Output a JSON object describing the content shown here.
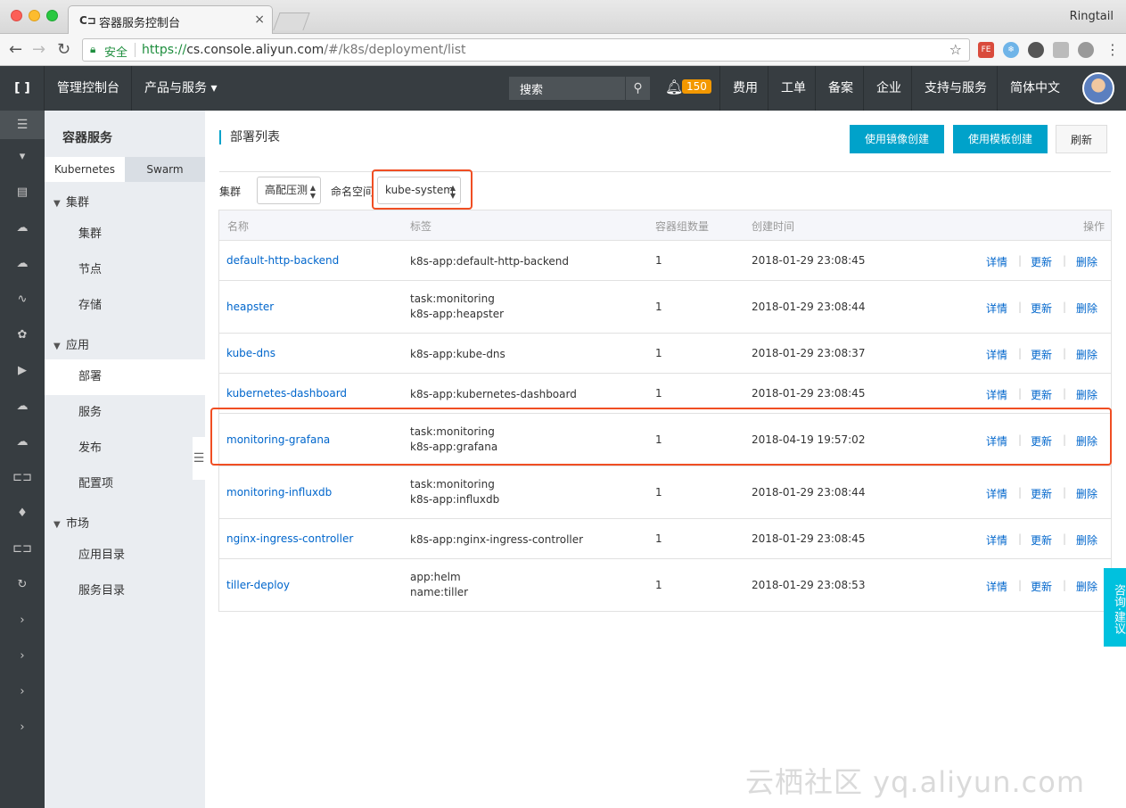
{
  "browser": {
    "tab_title": "容器服务控制台",
    "tab_icon": "C⊐",
    "profile_name": "Ringtail",
    "secure_label": "安全",
    "url_scheme": "https://",
    "url_host": "cs.console.aliyun.com",
    "url_path": "/#/k8s/deployment/list",
    "back_icon": "←",
    "forward_icon": "→",
    "reload_icon": "↻",
    "star_icon": "☆",
    "menu_icon": "⋮",
    "ext_fe": "FE"
  },
  "topnav": {
    "logo": "[ ]",
    "console_label": "管理控制台",
    "products_label": "产品与服务 ▾",
    "search_placeholder": "搜索",
    "notification_count": "150",
    "items": [
      "费用",
      "工单",
      "备案",
      "企业",
      "支持与服务",
      "简体中文"
    ]
  },
  "sidebar": {
    "title": "容器服务",
    "tabs": [
      "Kubernetes",
      "Swarm"
    ],
    "groups": [
      {
        "label": "集群",
        "items": [
          "集群",
          "节点",
          "存储"
        ]
      },
      {
        "label": "应用",
        "items": [
          "部署",
          "服务",
          "发布",
          "配置项"
        ]
      },
      {
        "label": "市场",
        "items": [
          "应用目录",
          "服务目录"
        ]
      }
    ],
    "active_item": "部署"
  },
  "main": {
    "title": "部署列表",
    "buttons": {
      "create_image": "使用镜像创建",
      "create_template": "使用模板创建",
      "refresh": "刷新"
    },
    "filters": {
      "cluster_label": "集群",
      "cluster_value": "高配压测",
      "namespace_label": "命名空间",
      "namespace_value": "kube-system"
    },
    "table": {
      "headers": [
        "名称",
        "标签",
        "容器组数量",
        "创建时间",
        "操作"
      ],
      "actions": [
        "详情",
        "更新",
        "删除"
      ],
      "rows": [
        {
          "name": "default-http-backend",
          "labels": [
            "k8s-app:default-http-backend"
          ],
          "pods": "1",
          "created": "2018-01-29 23:08:45"
        },
        {
          "name": "heapster",
          "labels": [
            "task:monitoring",
            "k8s-app:heapster"
          ],
          "pods": "1",
          "created": "2018-01-29 23:08:44"
        },
        {
          "name": "kube-dns",
          "labels": [
            "k8s-app:kube-dns"
          ],
          "pods": "1",
          "created": "2018-01-29 23:08:37"
        },
        {
          "name": "kubernetes-dashboard",
          "labels": [
            "k8s-app:kubernetes-dashboard"
          ],
          "pods": "1",
          "created": "2018-01-29 23:08:45"
        },
        {
          "name": "monitoring-grafana",
          "labels": [
            "task:monitoring",
            "k8s-app:grafana"
          ],
          "pods": "1",
          "created": "2018-04-19 19:57:02"
        },
        {
          "name": "monitoring-influxdb",
          "labels": [
            "task:monitoring",
            "k8s-app:influxdb"
          ],
          "pods": "1",
          "created": "2018-01-29 23:08:44"
        },
        {
          "name": "nginx-ingress-controller",
          "labels": [
            "k8s-app:nginx-ingress-controller"
          ],
          "pods": "1",
          "created": "2018-01-29 23:08:45"
        },
        {
          "name": "tiller-deploy",
          "labels": [
            "app:helm",
            "name:tiller"
          ],
          "pods": "1",
          "created": "2018-01-29 23:08:53"
        }
      ]
    }
  },
  "feedback_label": "咨询·建议",
  "watermark": "云栖社区 yq.aliyun.com",
  "colors": {
    "accent": "#00a2ca",
    "nav_bg": "#373d41",
    "link": "#0066cc",
    "highlight": "#f04e23",
    "badge": "#f39800"
  }
}
